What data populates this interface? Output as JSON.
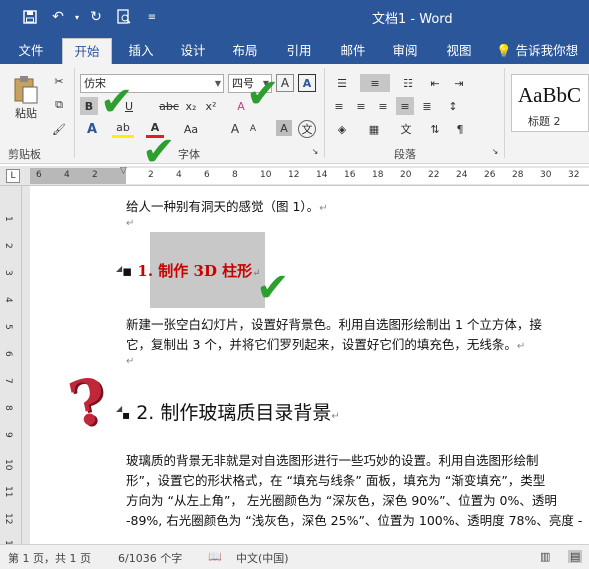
{
  "window": {
    "title": "文档1 - Word"
  },
  "qat": {
    "save_icon": "save-icon",
    "undo_icon": "undo-icon",
    "redo_icon": "redo-icon",
    "preview_icon": "print-preview-icon",
    "customize_icon": "customize-qat-icon"
  },
  "tabs": [
    "文件",
    "开始",
    "插入",
    "设计",
    "布局",
    "引用",
    "邮件",
    "审阅",
    "视图"
  ],
  "tell_me": "告诉我你想要",
  "ribbon": {
    "clipboard": {
      "paste_label": "粘贴",
      "group_label": "剪贴板"
    },
    "font": {
      "font_name": "仿宋",
      "font_size": "四号",
      "group_label": "字体",
      "bold": "B",
      "italic": "I",
      "underline": "U",
      "strike": "abc",
      "sub": "x₂",
      "sup": "x²",
      "change_case": "Aa",
      "grow": "A",
      "shrink": "A",
      "clear": "A",
      "char_border": "A",
      "phonetic": "文"
    },
    "paragraph": {
      "group_label": "段落"
    },
    "styles": {
      "preview": "AaBbC",
      "name": "标题 2"
    }
  },
  "ruler": {
    "ticks": [
      "6",
      "4",
      "2",
      "",
      "2",
      "4",
      "6",
      "8",
      "10",
      "12",
      "14",
      "16",
      "18",
      "20",
      "22",
      "24",
      "26",
      "28",
      "30",
      "32"
    ]
  },
  "vruler": {
    "ticks": [
      "1",
      "2",
      "3",
      "4",
      "5",
      "6",
      "7",
      "8",
      "9",
      "10",
      "11",
      "12",
      "13"
    ]
  },
  "document": {
    "line1": "给人一种别有洞天的感觉（图 1）。",
    "heading1": "1.  制作 3D 柱形",
    "para1_l1": "新建一张空白幻灯片，设置好背景色。利用自选图形绘制出 1 个立方体，接",
    "para1_l2": "它，复制出 3 个，并将它们罗列起来，设置好它们的填充色，无线条。",
    "heading2": "2. 制作玻璃质目录背景",
    "para2_l1": "玻璃质的背景无非就是对自选图形进行一些巧妙的设置。利用自选图形绘制",
    "para2_l2": "形”，设置它的形状格式，在 “填充与线条” 面板，填充为 “渐变填充”，类型",
    "para2_l3": "方向为 “从左上角”， 左光圈颜色为 “深灰色，深色 90%”、位置为 0%、透明",
    "para2_l4": "-89%, 右光圈颜色为 “浅灰色，深色 25%”、位置为 100%、透明度 78%、亮度 -",
    "para_mark": "↵"
  },
  "status": {
    "page": "第 1 页，共 1 页",
    "words": "6/1036 个字",
    "lang": "中文(中国)"
  },
  "colors": {
    "accent": "#2b579a",
    "heading_red": "#cc0000",
    "check_green": "#2e9e2e",
    "question_red": "#c0283a"
  }
}
